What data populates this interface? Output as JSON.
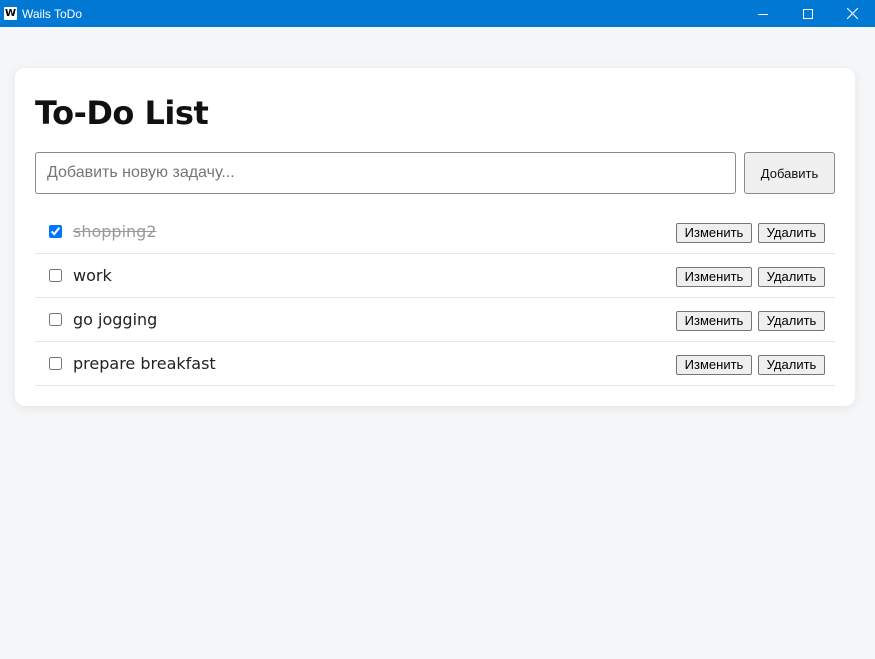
{
  "window": {
    "title": "Wails ToDo",
    "app_icon_letter": "W",
    "accent": "#0078d4",
    "controls": [
      "minimize-icon",
      "maximize-icon",
      "close-icon"
    ]
  },
  "page": {
    "title": "To-Do List"
  },
  "new_task": {
    "placeholder": "Добавить новую задачу...",
    "value": "",
    "add_label": "Добавить"
  },
  "todos": [
    {
      "text": "shopping2",
      "done": true,
      "edit_label": "Изменить",
      "delete_label": "Удалить"
    },
    {
      "text": "work",
      "done": false,
      "edit_label": "Изменить",
      "delete_label": "Удалить"
    },
    {
      "text": "go jogging",
      "done": false,
      "edit_label": "Изменить",
      "delete_label": "Удалить"
    },
    {
      "text": "prepare breakfast",
      "done": false,
      "edit_label": "Изменить",
      "delete_label": "Удалить"
    }
  ]
}
